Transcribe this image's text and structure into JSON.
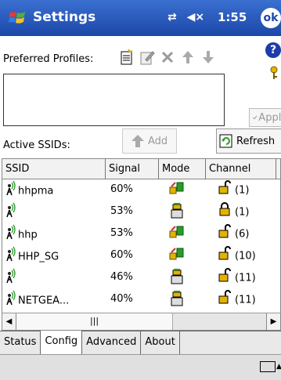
{
  "titlebar": {
    "title": "Settings",
    "time": "1:55",
    "ok_label": "ok",
    "status_icons": [
      "connectivity-icon",
      "speaker-mute-icon"
    ]
  },
  "preferred": {
    "label": "Preferred Profiles:",
    "toolbar": [
      "new-profile-icon",
      "edit-profile-icon",
      "delete-icon",
      "move-up-icon",
      "move-down-icon"
    ],
    "help_label": "?",
    "apply_label": "Apply"
  },
  "active": {
    "label": "Active SSIDs:",
    "add_label": "Add",
    "refresh_label": "Refresh"
  },
  "table": {
    "columns": [
      "SSID",
      "Signal",
      "Mode",
      "Channel"
    ],
    "rows": [
      {
        "ssid": "hhpma",
        "signal": "60%",
        "mode": "infrastructure",
        "secured": false,
        "channel": "(1)"
      },
      {
        "ssid": "",
        "signal": "53%",
        "mode": "adhoc",
        "secured": true,
        "channel": "(1)"
      },
      {
        "ssid": "hhp",
        "signal": "53%",
        "mode": "infrastructure",
        "secured": false,
        "channel": "(6)"
      },
      {
        "ssid": "HHP_SG",
        "signal": "60%",
        "mode": "infrastructure",
        "secured": false,
        "channel": "(10)"
      },
      {
        "ssid": "",
        "signal": "46%",
        "mode": "adhoc",
        "secured": false,
        "channel": "(11)"
      },
      {
        "ssid": "NETGEA...",
        "signal": "40%",
        "mode": "adhoc",
        "secured": false,
        "channel": "(11)"
      }
    ],
    "scroll_thumb": "|||"
  },
  "tabs": [
    "Status",
    "Config",
    "Advanced",
    "About"
  ],
  "active_tab": "Config",
  "colors": {
    "titlebar": "#1c48a8",
    "lock": "#e2b400"
  }
}
